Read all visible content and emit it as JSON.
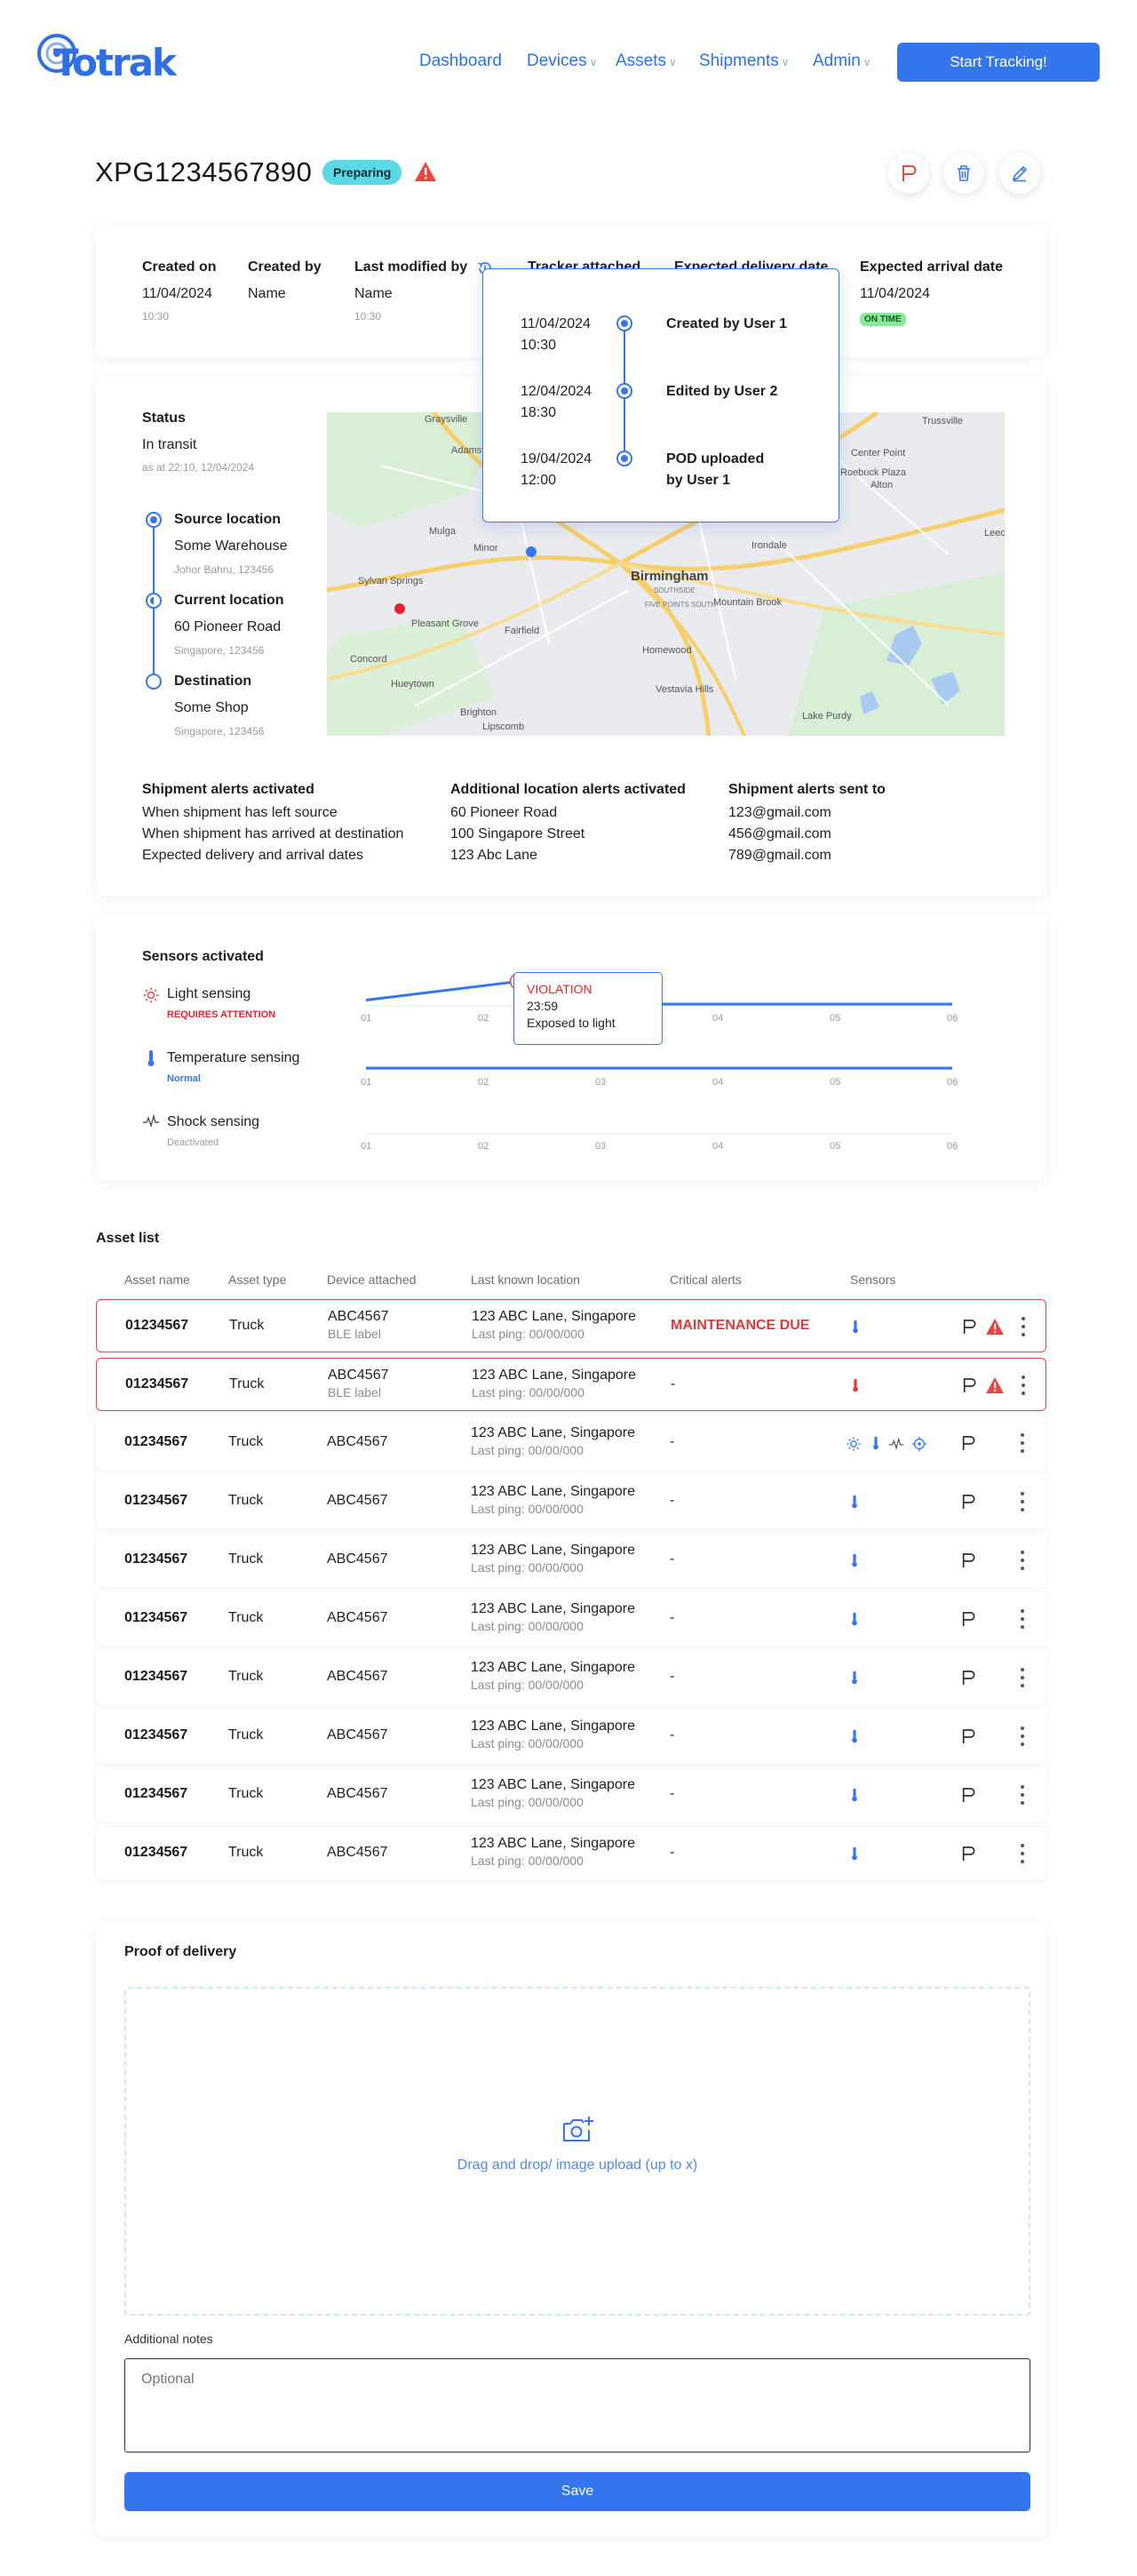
{
  "brand": {
    "logo_text": "Totrak",
    "accent": "#3576ef"
  },
  "nav": {
    "items": [
      {
        "label": "Dashboard",
        "has_menu": false
      },
      {
        "label": "Devices",
        "has_menu": true
      },
      {
        "label": "Assets",
        "has_menu": true
      },
      {
        "label": "Shipments",
        "has_menu": true
      },
      {
        "label": "Admin",
        "has_menu": true
      }
    ],
    "cta": "Start Tracking!"
  },
  "shipment": {
    "id": "XPG1234567890",
    "status_badge": "Preparing",
    "actions": [
      "flag-icon",
      "trash-icon",
      "pencil-icon"
    ]
  },
  "info": {
    "created_on": {
      "label": "Created on",
      "value": "11/04/2024",
      "time": "10:30"
    },
    "created_by": {
      "label": "Created by",
      "value": "Name"
    },
    "last_modified_by": {
      "label": "Last modified by",
      "value": "Name",
      "time": "10:30"
    },
    "tracker_attached": {
      "label": "Tracker attached"
    },
    "expected_delivery": {
      "label": "Expected delivery date"
    },
    "expected_arrival": {
      "label": "Expected arrival date",
      "value": "11/04/2024",
      "badge": "ON TIME"
    }
  },
  "history": [
    {
      "date": "11/04/2024",
      "time": "10:30",
      "event": "Created by User 1"
    },
    {
      "date": "12/04/2024",
      "time": "18:30",
      "event": "Edited by User 2"
    },
    {
      "date": "19/04/2024",
      "time": "12:00",
      "event": "POD uploaded",
      "event2": "by User 1"
    }
  ],
  "status": {
    "label": "Status",
    "value": "In transit",
    "as_at": "as at 22:10, 12/04/2024",
    "source": {
      "label": "Source location",
      "name": "Some Warehouse",
      "address": "Johor Bahru, 123456"
    },
    "current": {
      "label": "Current location",
      "name": "60 Pioneer Road",
      "address": "Singapore, 123456"
    },
    "destination": {
      "label": "Destination",
      "name": "Some Shop",
      "address": "Singapore, 123456"
    }
  },
  "map": {
    "labels": [
      "Graysville",
      "Adamsville",
      "Trussville",
      "Mulga",
      "Minor",
      "Birmingham",
      "Irondale",
      "Sylvan Springs",
      "Pleasant Grove",
      "Fairfield",
      "Homewood",
      "Mountain Brook",
      "Concord",
      "Hueytown",
      "Brighton",
      "Lipscomb",
      "Vestavia Hills",
      "Lake Purdy",
      "Alton",
      "Leeds",
      "Center Point",
      "Roebuck Plaza",
      "SOUTHSIDE",
      "FIVE POINTS SOUTH"
    ]
  },
  "alerts": {
    "shipment": {
      "title": "Shipment alerts activated",
      "items": [
        "When shipment has left source",
        "When shipment has arrived at destination",
        "Expected delivery and arrival dates"
      ]
    },
    "location": {
      "title": "Additional location alerts activated",
      "items": [
        "60 Pioneer Road",
        "100 Singapore Street",
        "123 Abc Lane"
      ]
    },
    "sent_to": {
      "title": "Shipment alerts sent to",
      "items": [
        "123@gmail.com",
        "456@gmail.com",
        "789@gmail.com"
      ]
    }
  },
  "sensors": {
    "title": "Sensors activated",
    "ticks": [
      "01",
      "02",
      "03",
      "04",
      "05",
      "06"
    ],
    "light": {
      "label": "Light sensing",
      "state": "REQUIRES ATTENTION"
    },
    "temperature": {
      "label": "Temperature sensing",
      "state": "Normal"
    },
    "shock": {
      "label": "Shock sensing",
      "state": "Deactivated"
    },
    "tooltip": {
      "title": "VIOLATION",
      "time": "23:59",
      "detail": "Exposed to light"
    }
  },
  "chart_data": {
    "type": "line",
    "x": [
      "01",
      "02",
      "03",
      "04",
      "05",
      "06"
    ],
    "series": [
      {
        "name": "Light sensing",
        "values": [
          0,
          0.55,
          1,
          0,
          0,
          0
        ],
        "violation_at": 2.3
      },
      {
        "name": "Temperature sensing",
        "values": [
          0,
          0,
          0,
          0,
          0,
          0
        ]
      },
      {
        "name": "Shock sensing",
        "values": []
      }
    ]
  },
  "assets": {
    "title": "Asset list",
    "columns": [
      "Asset name",
      "Asset type",
      "Device attached",
      "Last known location",
      "Critical alerts",
      "Sensors"
    ],
    "rows": [
      {
        "name": "01234567",
        "type": "Truck",
        "device": "ABC4567",
        "device_sub": "BLE label",
        "location": "123 ABC Lane, Singapore",
        "ping": "Last ping: 00/00/000",
        "alert": "MAINTENANCE DUE",
        "critical": true,
        "temp_color": "#3576ef",
        "warn": true,
        "multi": false
      },
      {
        "name": "01234567",
        "type": "Truck",
        "device": "ABC4567",
        "device_sub": "BLE label",
        "location": "123 ABC Lane, Singapore",
        "ping": "Last ping: 00/00/000",
        "alert": "-",
        "critical": true,
        "temp_color": "#e23838",
        "warn": true,
        "multi": false
      },
      {
        "name": "01234567",
        "type": "Truck",
        "device": "ABC4567",
        "device_sub": "",
        "location": "123 ABC Lane, Singapore",
        "ping": "Last ping: 00/00/000",
        "alert": "-",
        "critical": false,
        "temp_color": "#3576ef",
        "warn": false,
        "multi": true
      },
      {
        "name": "01234567",
        "type": "Truck",
        "device": "ABC4567",
        "device_sub": "",
        "location": "123 ABC Lane, Singapore",
        "ping": "Last ping: 00/00/000",
        "alert": "-",
        "critical": false,
        "temp_color": "#3576ef",
        "warn": false,
        "multi": false
      },
      {
        "name": "01234567",
        "type": "Truck",
        "device": "ABC4567",
        "device_sub": "",
        "location": "123 ABC Lane, Singapore",
        "ping": "Last ping: 00/00/000",
        "alert": "-",
        "critical": false,
        "temp_color": "#3576ef",
        "warn": false,
        "multi": false
      },
      {
        "name": "01234567",
        "type": "Truck",
        "device": "ABC4567",
        "device_sub": "",
        "location": "123 ABC Lane, Singapore",
        "ping": "Last ping: 00/00/000",
        "alert": "-",
        "critical": false,
        "temp_color": "#3576ef",
        "warn": false,
        "multi": false
      },
      {
        "name": "01234567",
        "type": "Truck",
        "device": "ABC4567",
        "device_sub": "",
        "location": "123 ABC Lane, Singapore",
        "ping": "Last ping: 00/00/000",
        "alert": "-",
        "critical": false,
        "temp_color": "#3576ef",
        "warn": false,
        "multi": false
      },
      {
        "name": "01234567",
        "type": "Truck",
        "device": "ABC4567",
        "device_sub": "",
        "location": "123 ABC Lane, Singapore",
        "ping": "Last ping: 00/00/000",
        "alert": "-",
        "critical": false,
        "temp_color": "#3576ef",
        "warn": false,
        "multi": false
      },
      {
        "name": "01234567",
        "type": "Truck",
        "device": "ABC4567",
        "device_sub": "",
        "location": "123 ABC Lane, Singapore",
        "ping": "Last ping: 00/00/000",
        "alert": "-",
        "critical": false,
        "temp_color": "#3576ef",
        "warn": false,
        "multi": false
      },
      {
        "name": "01234567",
        "type": "Truck",
        "device": "ABC4567",
        "device_sub": "",
        "location": "123 ABC Lane, Singapore",
        "ping": "Last ping: 00/00/000",
        "alert": "-",
        "critical": false,
        "temp_color": "#3576ef",
        "warn": false,
        "multi": false
      }
    ]
  },
  "pod": {
    "title": "Proof of delivery",
    "upload_text": "Drag and drop/ image upload (up to x)",
    "notes_label": "Additional notes",
    "notes_placeholder": "Optional",
    "save": "Save"
  }
}
